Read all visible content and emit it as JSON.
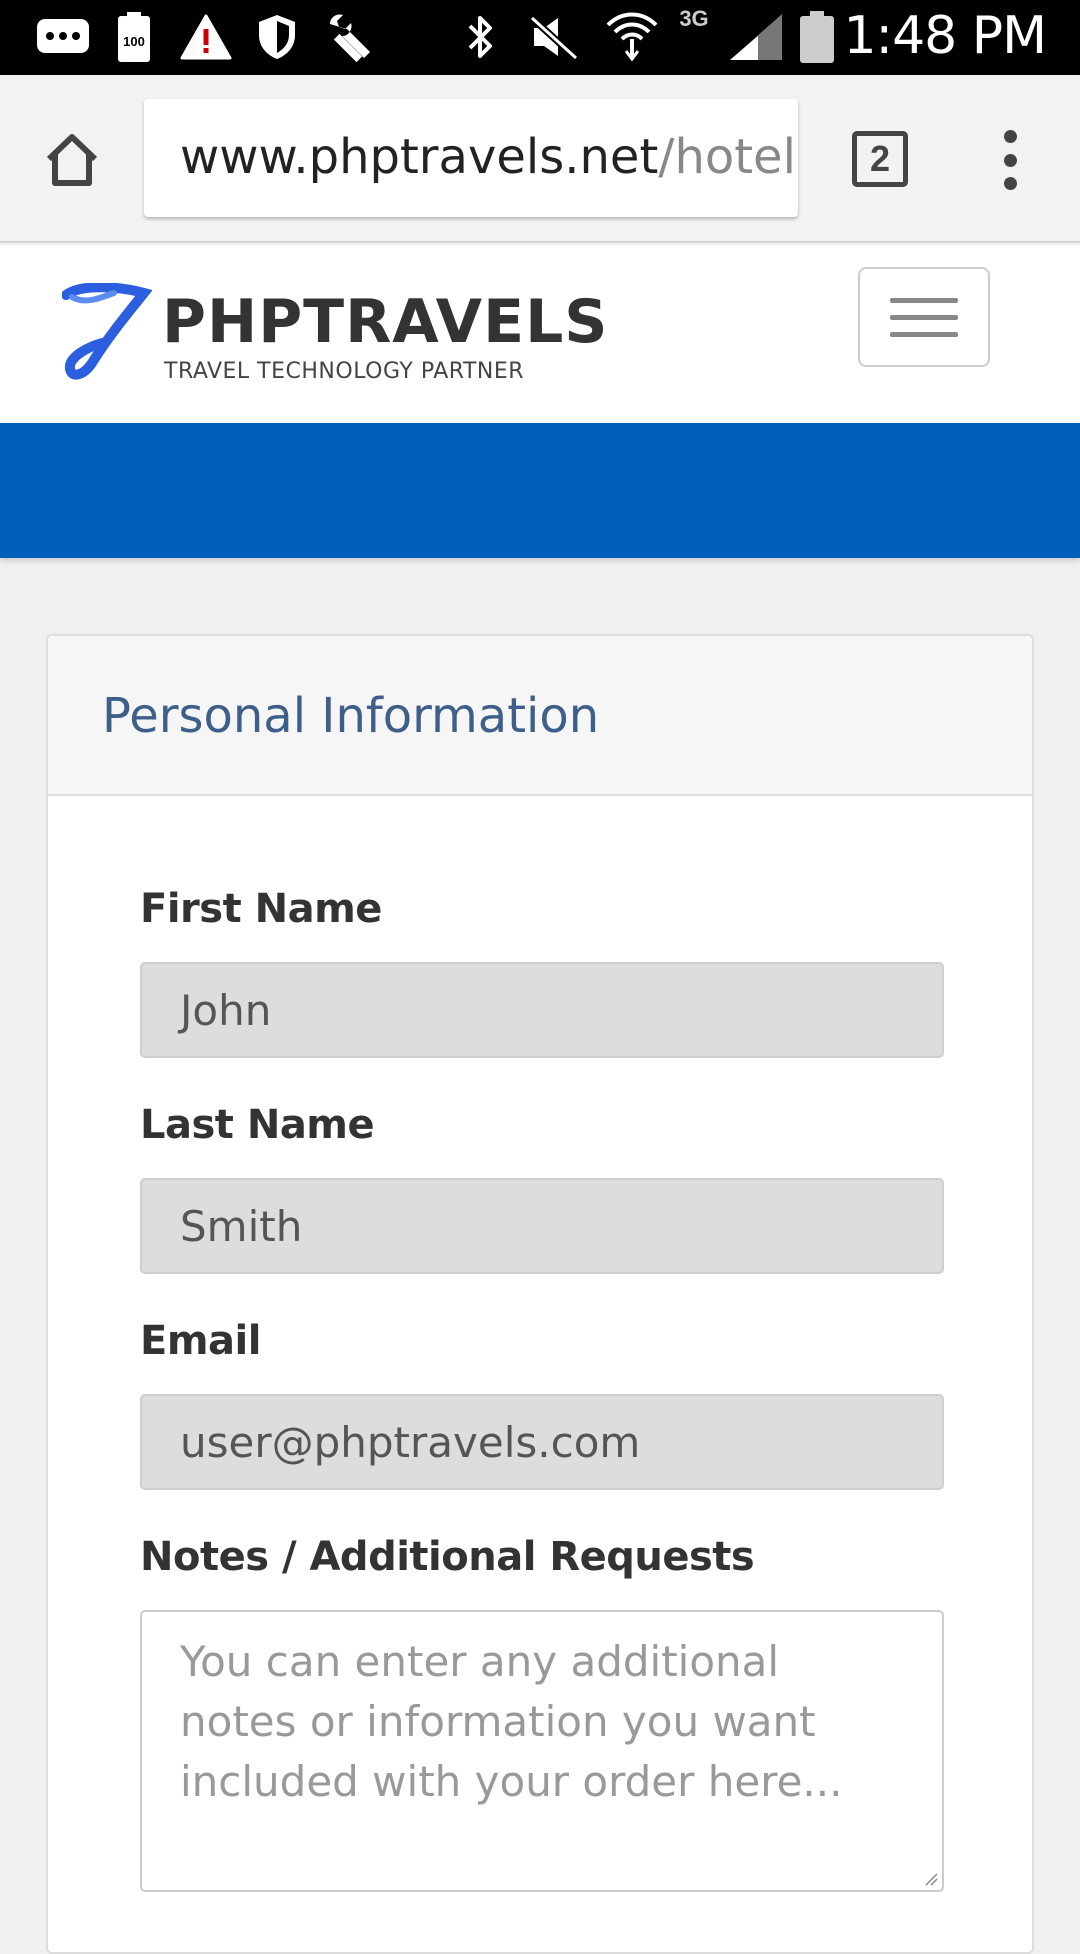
{
  "status_bar": {
    "time": "1:48 PM",
    "battery_badge": "100",
    "network_label": "3G",
    "icons": [
      "messages-icon",
      "battery-100-icon",
      "alert-icon",
      "shield-icon",
      "wrench-icon",
      "bluetooth-icon",
      "mute-icon",
      "wifi-icon",
      "signal-icon",
      "battery-icon"
    ]
  },
  "browser": {
    "url_host": "www.phptravels.net",
    "url_path": "/hotels/",
    "tab_count": "2"
  },
  "site": {
    "brand": "PHPTRAVELS",
    "tagline": "TRAVEL TECHNOLOGY PARTNER",
    "accent_color": "#005fba"
  },
  "panel": {
    "title": "Personal Information",
    "fields": [
      {
        "label": "First Name",
        "value": "John"
      },
      {
        "label": "Last Name",
        "value": "Smith"
      },
      {
        "label": "Email",
        "value": "user@phptravels.com"
      }
    ],
    "notes": {
      "label": "Notes / Additional Requests",
      "placeholder": "You can enter any additional notes or information you want included with your order here..."
    }
  }
}
